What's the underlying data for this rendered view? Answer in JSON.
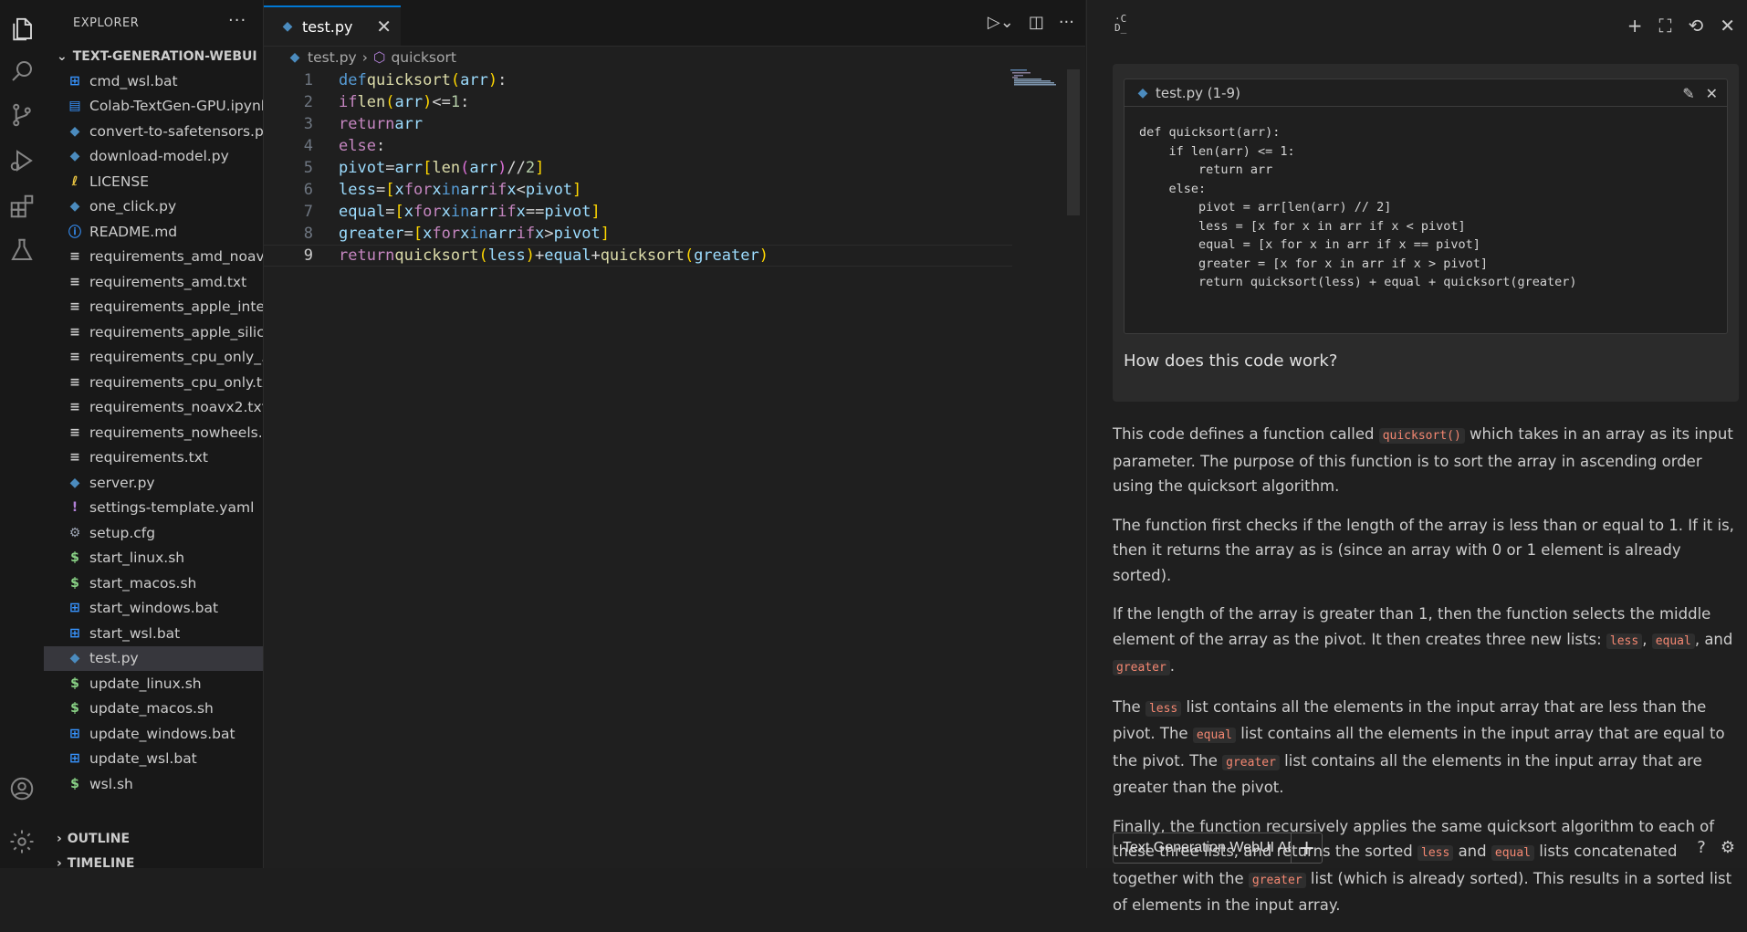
{
  "sidebar": {
    "title": "EXPLORER",
    "more": "···",
    "root": "TEXT-GENERATION-WEBUI",
    "files": [
      {
        "name": "cmd_wsl.bat",
        "icon": "windows-icon"
      },
      {
        "name": "Colab-TextGen-GPU.ipynb",
        "icon": "notebook-icon"
      },
      {
        "name": "convert-to-safetensors.py",
        "icon": "python-icon"
      },
      {
        "name": "download-model.py",
        "icon": "python-icon"
      },
      {
        "name": "LICENSE",
        "icon": "license-icon"
      },
      {
        "name": "one_click.py",
        "icon": "python-icon"
      },
      {
        "name": "README.md",
        "icon": "info-icon"
      },
      {
        "name": "requirements_amd_noav...",
        "icon": "text-file-icon"
      },
      {
        "name": "requirements_amd.txt",
        "icon": "text-file-icon"
      },
      {
        "name": "requirements_apple_inte...",
        "icon": "text-file-icon"
      },
      {
        "name": "requirements_apple_silic...",
        "icon": "text-file-icon"
      },
      {
        "name": "requirements_cpu_only_...",
        "icon": "text-file-icon"
      },
      {
        "name": "requirements_cpu_only.txt",
        "icon": "text-file-icon"
      },
      {
        "name": "requirements_noavx2.txt",
        "icon": "text-file-icon"
      },
      {
        "name": "requirements_nowheels....",
        "icon": "text-file-icon"
      },
      {
        "name": "requirements.txt",
        "icon": "text-file-icon"
      },
      {
        "name": "server.py",
        "icon": "python-icon"
      },
      {
        "name": "settings-template.yaml",
        "icon": "yaml-icon"
      },
      {
        "name": "setup.cfg",
        "icon": "gear-file-icon"
      },
      {
        "name": "start_linux.sh",
        "icon": "shell-icon"
      },
      {
        "name": "start_macos.sh",
        "icon": "shell-icon"
      },
      {
        "name": "start_windows.bat",
        "icon": "windows-icon"
      },
      {
        "name": "start_wsl.bat",
        "icon": "windows-icon"
      },
      {
        "name": "test.py",
        "icon": "python-icon"
      },
      {
        "name": "update_linux.sh",
        "icon": "shell-icon"
      },
      {
        "name": "update_macos.sh",
        "icon": "shell-icon"
      },
      {
        "name": "update_windows.bat",
        "icon": "windows-icon"
      },
      {
        "name": "update_wsl.bat",
        "icon": "windows-icon"
      },
      {
        "name": "wsl.sh",
        "icon": "shell-icon"
      }
    ],
    "active_file": "test.py",
    "outline": "OUTLINE",
    "timeline": "TIMELINE"
  },
  "editor": {
    "tab": "test.py",
    "tab_close": "✕",
    "breadcrumb_file": "test.py",
    "breadcrumb_symbol": "quicksort",
    "line_numbers": [
      "1",
      "2",
      "3",
      "4",
      "5",
      "6",
      "7",
      "8",
      "9"
    ],
    "current_line": 9
  },
  "panel": {
    "logo_top": "·C",
    "logo_bottom": "D_",
    "snippet_title": "test.py (1-9)",
    "snippet_code": "def quicksort(arr):\n    if len(arr) <= 1:\n        return arr\n    else:\n        pivot = arr[len(arr) // 2]\n        less = [x for x in arr if x < pivot]\n        equal = [x for x in arr if x == pivot]\n        greater = [x for x in arr if x > pivot]\n        return quicksort(less) + equal + quicksort(greater)",
    "question": "How does this code work?",
    "answer": {
      "p1a": "This code defines a function called ",
      "p1code": "quicksort()",
      "p1b": " which takes in an array as its input parameter. The purpose of this function is to sort the array in ascending order using the quicksort algorithm.",
      "p2": "The function first checks if the length of the array is less than or equal to 1. If it is, then it returns the array as is (since an array with 0 or 1 element is already sorted).",
      "p3a": "If the length of the array is greater than 1, then the function selects the middle element of the array as the pivot. It then creates three new lists: ",
      "c_less": "less",
      "c_equal": "equal",
      "c_greater": "greater",
      "sep_comma": ", ",
      "sep_and": ", and ",
      "dot": ".",
      "p4a": "The ",
      "p4b": " list contains all the elements in the input array that are less than the pivot. The ",
      "p4c": " list contains all the elements in the input array that are equal to the pivot. The ",
      "p4d": " list contains all the elements in the input array that are greater than the pivot.",
      "p5a": "Finally, the function recursively applies the same quicksort algorithm to each of these three lists, and returns the sorted ",
      "and": " and ",
      "p5b": " lists concatenated together with the ",
      "p5c": " list (which is already sorted). This results in a sorted list of elements in the input array."
    },
    "api_label": "Text Generation WebUI API S",
    "api_plus": "+"
  },
  "colors": {
    "accent": "#0078d4",
    "background": "#1e1e1e",
    "sidebar": "#181818",
    "selection": "#37373d"
  }
}
